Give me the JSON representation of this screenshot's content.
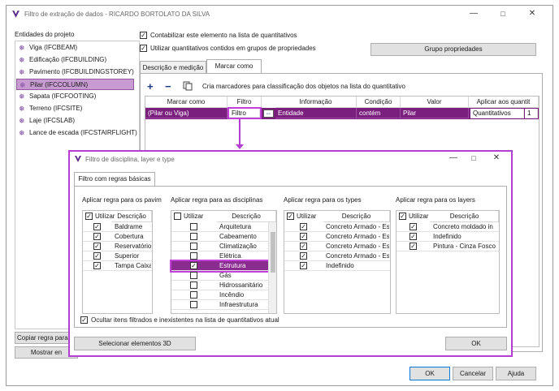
{
  "main": {
    "title": "Filtro de extração de dados - RICARDO BORTOLATO DA SILVA",
    "entities_label": "Entidades do projeto",
    "entities": [
      "Viga (IFCBEAM)",
      "Edificação (IFCBUILDING)",
      "Pavimento (IFCBUILDINGSTOREY)",
      "Pilar (IFCCOLUMN)",
      "Sapata (IFCFOOTING)",
      "Terreno (IFCSITE)",
      "Laje (IFCSLAB)",
      "Lance de escada (IFCSTAIRFLIGHT)"
    ],
    "selected_entity": 3,
    "opt_count": "Contabilizar este elemento na lista de quantitativos",
    "opt_group": "Utilizar quantitativos contidos em grupos de propriedades",
    "group_btn": "Grupo propriedades",
    "tabs": [
      "Descrição e medição",
      "Marcar como"
    ],
    "add_icon": "+",
    "remove_icon": "−",
    "marker_text": "Cria marcadores para classificação dos objetos na lista do quantitativo",
    "marker_headers": [
      "Marcar como",
      "Filtro",
      "Informação",
      "Condição",
      "Valor",
      "Aplicar aos quantit"
    ],
    "marker_row": {
      "mark": "(Pilar ou Viga)",
      "filter": "Filtro",
      "info": "Entidade",
      "cond": "contém",
      "value": "Pilar",
      "apply": "Quantitativos",
      "num": "1"
    },
    "copy_btn": "Copiar regra para...",
    "show_btn": "Mostrar en",
    "ok": "OK",
    "cancel": "Cancelar",
    "help": "Ajuda"
  },
  "dialog": {
    "title": "Filtro de disciplina, layer e type",
    "tab": "Filtro com regras básicas",
    "use_label": "Utilizar",
    "desc_label": "Descrição",
    "sections": [
      {
        "title": "Aplicar regra para os pavim",
        "rows": [
          {
            "text": "Baldrame",
            "checked": true
          },
          {
            "text": "Cobertura",
            "checked": true
          },
          {
            "text": "Reservatório",
            "checked": true
          },
          {
            "text": "Superior",
            "checked": true
          },
          {
            "text": "Tampa Caixa",
            "checked": true
          }
        ]
      },
      {
        "title": "Aplicar regra para as disciplinas",
        "rows": [
          {
            "text": "Arquitetura",
            "checked": false
          },
          {
            "text": "Cabeamento",
            "checked": false
          },
          {
            "text": "Climatização",
            "checked": false
          },
          {
            "text": "Elétrica",
            "checked": false
          },
          {
            "text": "Estrutura",
            "checked": true
          },
          {
            "text": "Gás",
            "checked": false
          },
          {
            "text": "Hidrossanitário",
            "checked": false
          },
          {
            "text": "Incêndio",
            "checked": false
          },
          {
            "text": "Infraestrutura",
            "checked": false
          }
        ]
      },
      {
        "title": "Aplicar regra para os types",
        "rows": [
          {
            "text": "Concreto Armado - Est",
            "checked": true
          },
          {
            "text": "Concreto Armado - Est",
            "checked": true
          },
          {
            "text": "Concreto Armado - Est",
            "checked": true
          },
          {
            "text": "Concreto Armado - Est",
            "checked": true
          },
          {
            "text": "Indefinido",
            "checked": true
          }
        ]
      },
      {
        "title": "Aplicar regra para os layers",
        "rows": [
          {
            "text": "Concreto moldado in",
            "checked": true
          },
          {
            "text": "Indefinido",
            "checked": true
          },
          {
            "text": "Pintura - Cinza Fosco",
            "checked": true
          }
        ]
      }
    ],
    "hide_label": "Ocultar itens filtrados e inexistentes na lista de quantitativos atual",
    "select3d": "Selecionar elementos 3D",
    "ok": "OK"
  }
}
